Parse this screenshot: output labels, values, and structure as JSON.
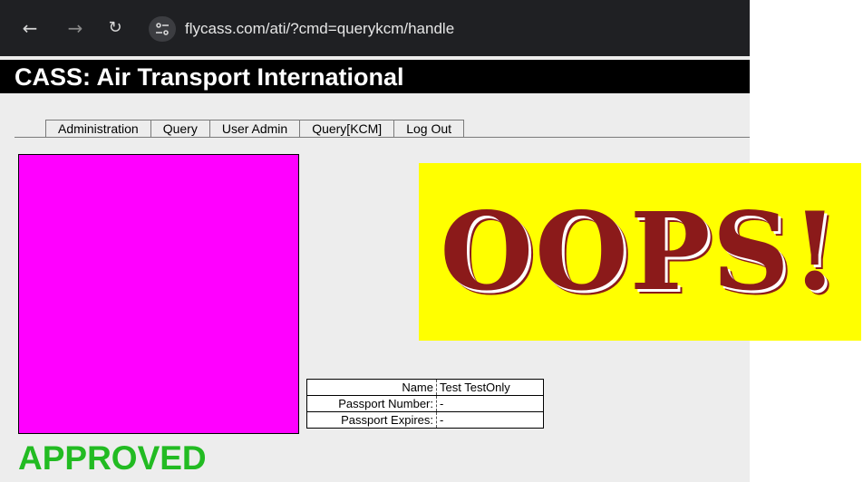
{
  "browser": {
    "url": "flycass.com/ati/?cmd=querykcm/handle",
    "back_icon": "arrow-left-icon",
    "forward_icon": "arrow-right-icon",
    "reload_icon": "reload-icon",
    "site_info_icon": "tune-icon"
  },
  "app": {
    "title": "CASS: Air Transport International"
  },
  "menu": {
    "items": [
      {
        "label": "Administration"
      },
      {
        "label": "Query"
      },
      {
        "label": "User Admin"
      },
      {
        "label": "Query[KCM]"
      },
      {
        "label": "Log Out"
      }
    ]
  },
  "record": {
    "photo_color": "#ff00ff",
    "fields": [
      {
        "label": "Name",
        "value": "Test TestOnly"
      },
      {
        "label": "Passport Number:",
        "value": "-"
      },
      {
        "label": "Passport Expires:",
        "value": "-"
      }
    ],
    "status": "APPROVED",
    "status_color": "#22bb22"
  },
  "overlay": {
    "text": "OOPS!",
    "background": "#ffff00",
    "color": "#8b1a1a"
  }
}
